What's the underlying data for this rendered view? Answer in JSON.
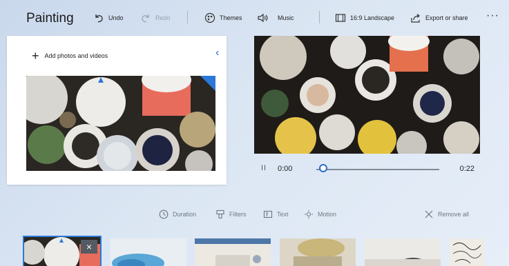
{
  "app": {
    "title": "Painting"
  },
  "toolbar": {
    "undo_label": "Undo",
    "redo_label": "Redo",
    "themes_label": "Themes",
    "music_label": "Music",
    "aspect_label": "16:9 Landscape",
    "export_label": "Export or share",
    "more_label": "···"
  },
  "library": {
    "add_label": "Add photos and videos",
    "collapse_icon": "‹"
  },
  "player": {
    "current_time": "0:00",
    "total_time": "0:22",
    "progress": 0.0,
    "pause_glyph": "II"
  },
  "storyboard": {
    "duration_label": "Duration",
    "filters_label": "Filters",
    "text_label": "Text",
    "motion_label": "Motion",
    "remove_all_label": "Remove all"
  },
  "clips": [
    {
      "name": "clip-paint-pots",
      "selected": true,
      "remove_glyph": "×"
    },
    {
      "name": "clip-blue-paint",
      "selected": false
    },
    {
      "name": "clip-palette",
      "selected": false
    },
    {
      "name": "clip-brushes",
      "selected": false
    },
    {
      "name": "clip-studio",
      "selected": false
    },
    {
      "name": "clip-sketch",
      "selected": false
    }
  ],
  "colors": {
    "accent": "#2b78d8",
    "text": "#1f1f1f",
    "muted": "#6d7782"
  }
}
